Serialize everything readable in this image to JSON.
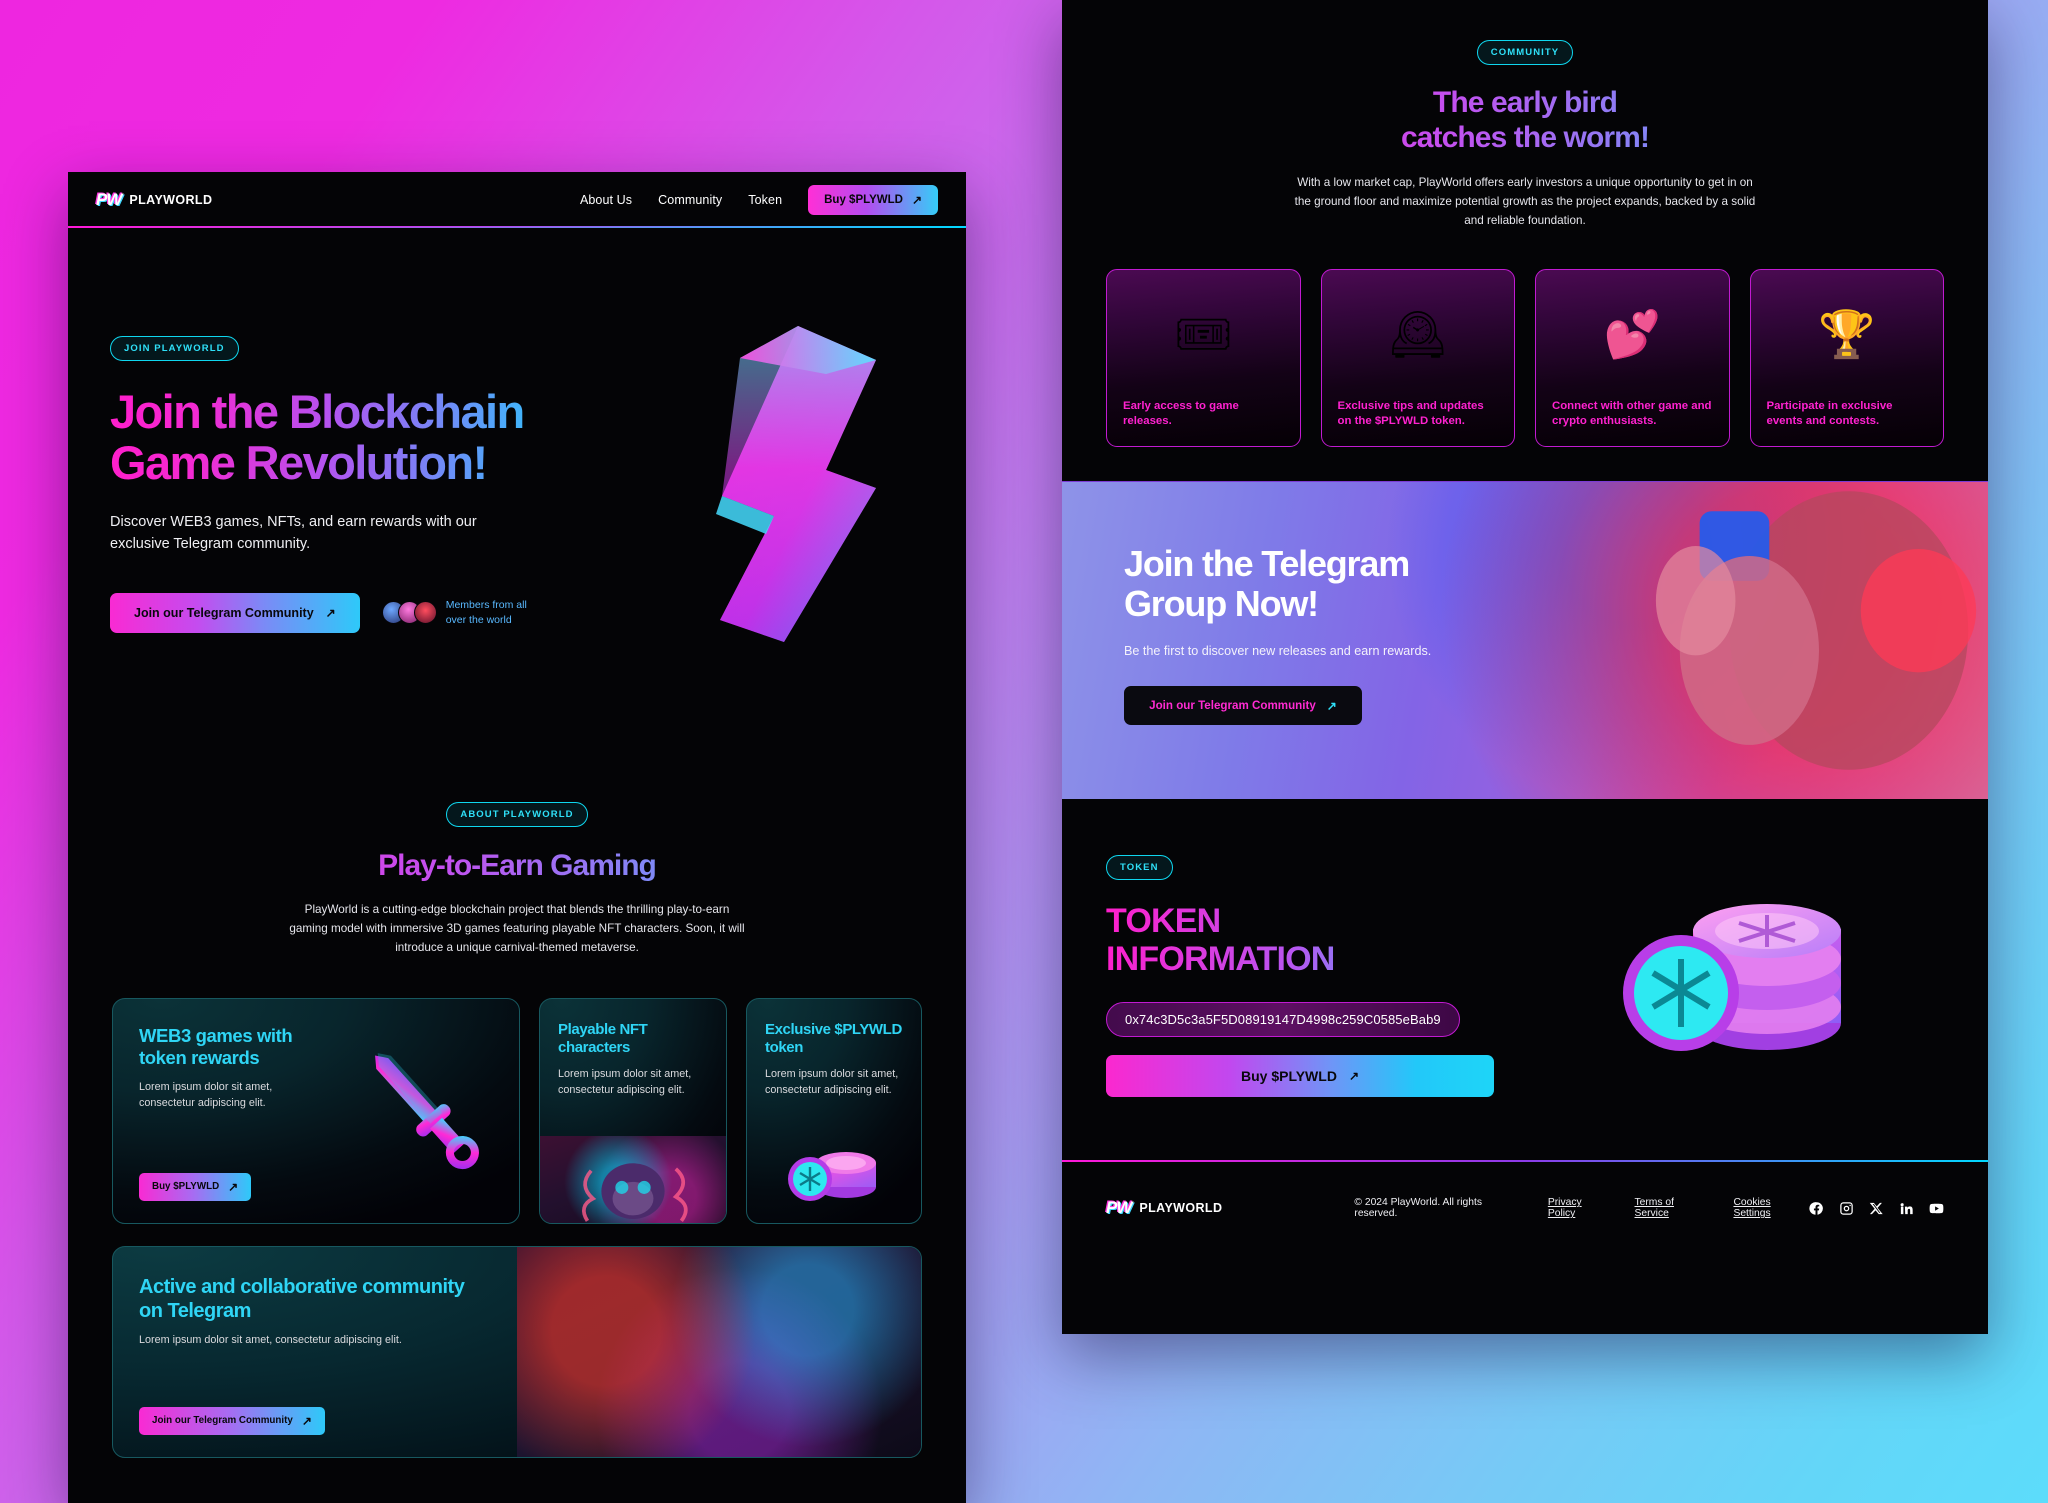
{
  "theme": {
    "bg_start": "#ee26e0",
    "bg_end": "#5cdcfb",
    "accent_pink": "#ff1ecb",
    "accent_cyan": "#2fd5f5",
    "panel_bg": "#040406",
    "magenta_border": "#c11ad1"
  },
  "nav": {
    "brand_mark": "PW",
    "brand_name": "PLAYWORLD",
    "links": [
      {
        "label": "About Us"
      },
      {
        "label": "Community"
      },
      {
        "label": "Token"
      }
    ],
    "cta_label": "Buy $PLYWLD",
    "arrow": "↗"
  },
  "hero": {
    "badge": "JOIN PLAYWORLD",
    "title": "Join the Blockchain Game Revolution!",
    "subtitle": "Discover WEB3 games, NFTs, and earn rewards with our exclusive Telegram community.",
    "cta_label": "Join our Telegram Community",
    "arrow": "↗",
    "members_text": "Members from all over the world"
  },
  "about": {
    "badge": "ABOUT PLAYWORLD",
    "title": "Play-to-Earn Gaming",
    "paragraph": "PlayWorld is a cutting-edge blockchain project that blends the thrilling play-to-earn gaming model with immersive 3D games featuring playable NFT characters. Soon, it will introduce a unique carnival-themed metaverse."
  },
  "feature_cards": [
    {
      "title": "WEB3 games with token rewards",
      "body": "Lorem ipsum dolor sit amet, consectetur adipiscing elit.",
      "cta": "Buy $PLYWLD",
      "art": "sword-icon"
    },
    {
      "title": "Playable NFT characters",
      "body": "Lorem ipsum dolor sit amet, consectetur adipiscing elit.",
      "art": "nft-monkey-photo"
    },
    {
      "title": "Exclusive $PLYWLD token",
      "body": "Lorem ipsum dolor sit amet, consectetur adipiscing elit.",
      "art": "coin-stack-icon"
    }
  ],
  "community_card": {
    "title": "Active and collaborative community on Telegram",
    "body": "Lorem ipsum dolor sit amet, consectetur adipiscing elit.",
    "cta": "Join our Telegram Community",
    "arrow": "↗"
  },
  "early_bird": {
    "badge": "COMMUNITY",
    "title_line1": "The early bird",
    "title_line2": "catches the worm!",
    "paragraph": "With a low market cap, PlayWorld offers early investors a unique opportunity to get in on the ground floor and maximize potential growth as the project expands, backed by a solid and reliable foundation."
  },
  "benefits": [
    {
      "text": "Early access to game releases.",
      "icon": "ticket-icon",
      "glyph": "🎟"
    },
    {
      "text": "Exclusive tips and updates on the $PLYWLD token.",
      "icon": "clock-icon",
      "glyph": "🕰"
    },
    {
      "text": "Connect with other game and crypto enthusiasts.",
      "icon": "hearts-icon",
      "glyph": "💕"
    },
    {
      "text": "Participate in exclusive events and contests.",
      "icon": "trophy-icon",
      "glyph": "🏆"
    }
  ],
  "telegram_banner": {
    "title_line1": "Join the Telegram",
    "title_line2": "Group Now!",
    "subtitle": "Be the first to discover new releases and earn rewards.",
    "cta": "Join our Telegram Community",
    "arrow": "↗"
  },
  "token": {
    "badge": "TOKEN",
    "title_line1": "TOKEN",
    "title_line2": "INFORMATION",
    "address": "0x74c3D5c3a5F5D08919147D4998c259C0585eBab9",
    "cta": "Buy $PLYWLD",
    "arrow": "↗",
    "art": "coin-stack-icon"
  },
  "footer": {
    "brand_mark": "PW",
    "brand_name": "PLAYWORLD",
    "copyright": "© 2024 PlayWorld. All rights reserved.",
    "links": [
      {
        "label": "Privacy Policy"
      },
      {
        "label": "Terms of Service"
      },
      {
        "label": "Cookies Settings"
      }
    ],
    "socials": [
      {
        "name": "facebook-icon"
      },
      {
        "name": "instagram-icon"
      },
      {
        "name": "x-icon"
      },
      {
        "name": "linkedin-icon"
      },
      {
        "name": "youtube-icon"
      }
    ]
  }
}
